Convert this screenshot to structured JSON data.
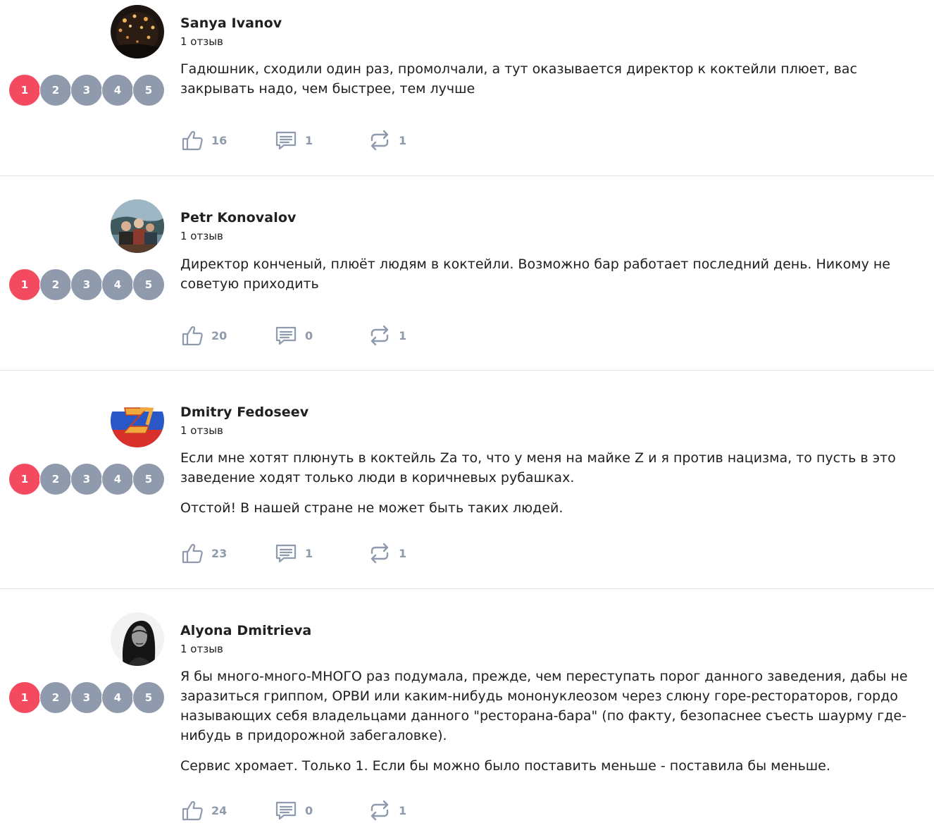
{
  "colors": {
    "rating_active": "#f34a5f",
    "rating_inactive": "#8f9aac",
    "action_icon": "#8f9aac",
    "divider": "#e4e4e4"
  },
  "reviews": [
    {
      "author": "Sanya Ivanov",
      "review_count": "1 отзыв",
      "rating": 1,
      "rating_options": [
        "1",
        "2",
        "3",
        "4",
        "5"
      ],
      "paragraphs": [
        "Гадюшник, сходили один раз, промолчали, а тут оказывается директор к коктейли плюет, вас закрывать надо, чем быстрее, тем лучше"
      ],
      "likes": "16",
      "comments": "1",
      "shares": "1"
    },
    {
      "author": "Petr Konovalov",
      "review_count": "1 отзыв",
      "rating": 1,
      "rating_options": [
        "1",
        "2",
        "3",
        "4",
        "5"
      ],
      "paragraphs": [
        "Директор конченый, плюёт людям в коктейли. Возможно бар работает последний день. Никому не советую приходить"
      ],
      "likes": "20",
      "comments": "0",
      "shares": "1"
    },
    {
      "author": "Dmitry Fedoseev",
      "review_count": "1 отзыв",
      "rating": 1,
      "rating_options": [
        "1",
        "2",
        "3",
        "4",
        "5"
      ],
      "paragraphs": [
        "Если мне хотят плюнуть в коктейль Za то, что у меня на майке Z и я против нацизма, то пусть в это заведение ходят только люди в коричневых рубашках.",
        "Отстой! В нашей стране не может быть таких людей."
      ],
      "likes": "23",
      "comments": "1",
      "shares": "1"
    },
    {
      "author": "Alyona Dmitrieva",
      "review_count": "1 отзыв",
      "rating": 1,
      "rating_options": [
        "1",
        "2",
        "3",
        "4",
        "5"
      ],
      "paragraphs": [
        "Я бы много-много-МНОГО раз подумала, прежде, чем переступать порог данного заведения, дабы не заразиться гриппом, ОРВИ или каким-нибудь мононуклеозом через слюну горе-рестораторов, гордо называющих себя владельцами данного \"ресторана-бара\" (по факту, безопаснее съесть шаурму где-нибудь в придорожной забегаловке).",
        "Сервис хромает. Только 1. Если бы можно было поставить меньше - поставила бы меньше."
      ],
      "likes": "24",
      "comments": "0",
      "shares": "1"
    }
  ]
}
